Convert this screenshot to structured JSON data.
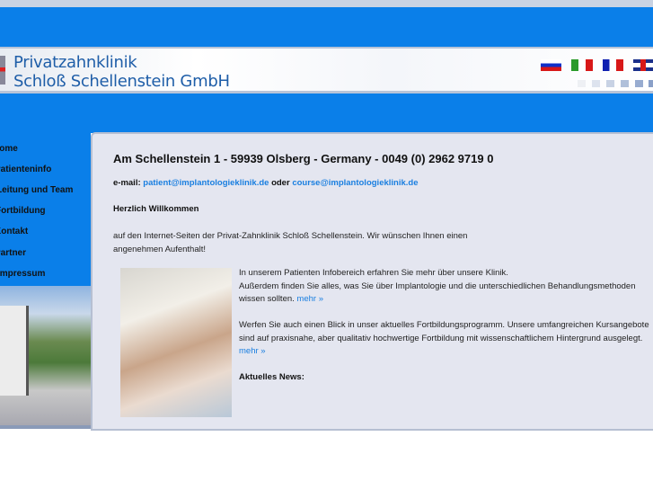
{
  "header": {
    "brand_line1": "Privatzahnklinik",
    "brand_line2": "Schloß Schellenstein GmbH",
    "flags": [
      "russian",
      "italian",
      "french",
      "english"
    ]
  },
  "sidebar": {
    "items": [
      {
        "label": "Home"
      },
      {
        "label": "Patienteninfo"
      },
      {
        "label": "Leitung und Team"
      },
      {
        "label": "Fortbildung"
      },
      {
        "label": "Kontakt"
      },
      {
        "label": "Partner"
      },
      {
        "label": "Impressum"
      }
    ]
  },
  "main": {
    "address": "Am Schellenstein 1 - 59939 Olsberg - Germany - 0049 (0) 2962 9719 0",
    "email_label": "e-mail:",
    "email1": "patient@implantologieklinik.de",
    "email_or": "oder",
    "email2": "course@implantologieklinik.de",
    "welcome": "Herzlich Willkommen",
    "intro": "auf den Internet-Seiten der Privat-Zahnklinik Schloß Schellenstein. Wir wünschen Ihnen einen angenehmen Aufenthalt!",
    "p1_line1": "In unserem Patienten Infobereich erfahren Sie mehr über unsere Klinik.",
    "p1_line2": "Außerdem finden Sie alles, was Sie über Implantologie und die unterschiedlichen Behandlungsmethoden",
    "p1_line3": "wissen sollten.",
    "more1": "mehr »",
    "p2_line1": "Werfen Sie auch einen Blick in unser aktuelles Fortbildungsprogramm. Unsere umfangreichen Kursangebote",
    "p2_line2": "sind auf praxisnahe, aber qualitativ hochwertige Fortbildung mit wissenschaftlichem Hintergrund ausgelegt.",
    "more2": "mehr »",
    "news": "Aktuelles News:"
  }
}
